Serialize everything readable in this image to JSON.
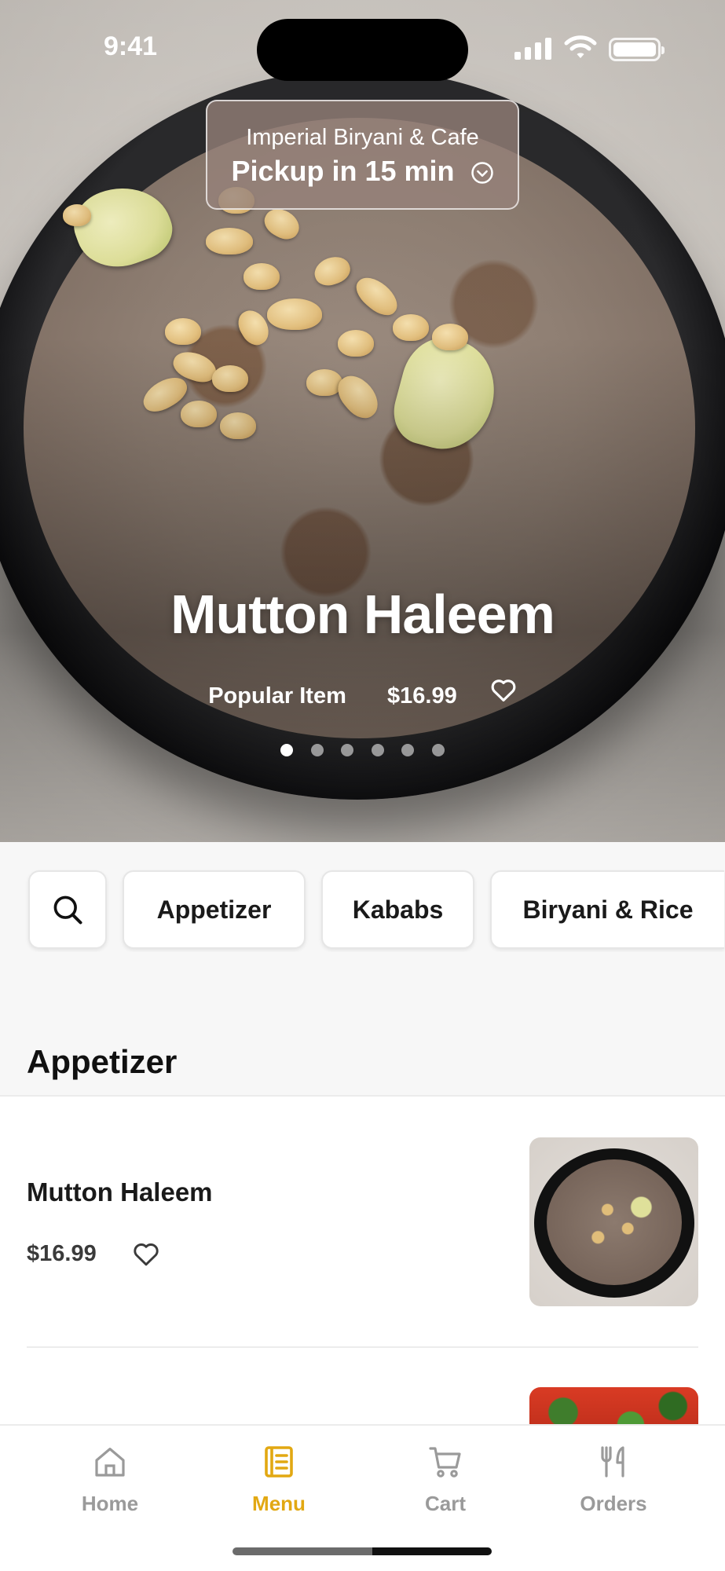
{
  "status_bar": {
    "time": "9:41"
  },
  "pickup": {
    "restaurant": "Imperial Biryani & Cafe",
    "pickup_time": "Pickup in 15 min"
  },
  "hero": {
    "title": "Mutton Haleem",
    "tag": "Popular Item",
    "price": "$16.99",
    "carousel_total": 6,
    "carousel_active": 1
  },
  "categories": {
    "search_icon": "search-icon",
    "items": [
      "Appetizer",
      "Kababs",
      "Biryani & Rice"
    ]
  },
  "section": {
    "title": "Appetizer"
  },
  "menu_items": [
    {
      "name": "Mutton Haleem",
      "price": "$16.99",
      "favorite_icon": "heart-outline-icon"
    }
  ],
  "tabbar": {
    "tabs": [
      {
        "label": "Home",
        "icon": "home-icon",
        "active": false
      },
      {
        "label": "Menu",
        "icon": "menu-book-icon",
        "active": true
      },
      {
        "label": "Cart",
        "icon": "cart-icon",
        "active": false
      },
      {
        "label": "Orders",
        "icon": "fork-knife-icon",
        "active": false
      }
    ]
  },
  "colors": {
    "accent": "#e2a812",
    "inactive": "#9a9a9a",
    "background": "#f7f7f7"
  }
}
